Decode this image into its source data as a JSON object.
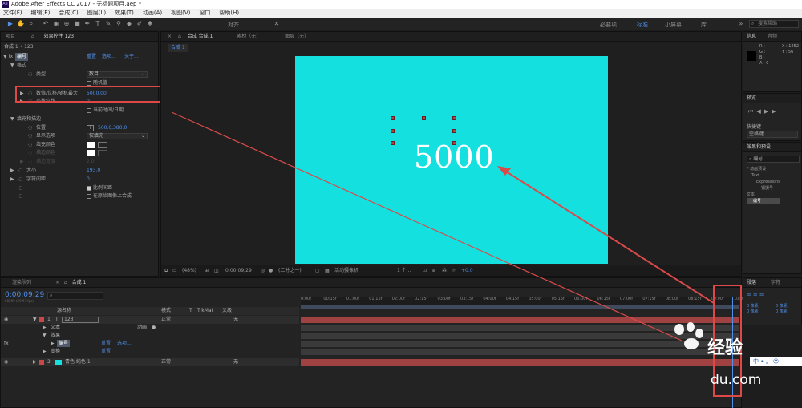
{
  "app": {
    "title": "Adobe After Effects CC 2017 - 无标题项目.aep *",
    "icon_label": "Ae"
  },
  "menu": [
    "文件(F)",
    "编辑(E)",
    "合成(C)",
    "图层(L)",
    "效果(T)",
    "动画(A)",
    "视图(V)",
    "窗口",
    "帮助(H)"
  ],
  "toolbar": {
    "align_label": "对齐",
    "workspaces": [
      "必要项",
      "标准",
      "小屏幕",
      "库"
    ],
    "active_workspace": "标准",
    "search_placeholder": "搜索帮助"
  },
  "effect_panel": {
    "tab_project": "项目",
    "tab_effect": "效果控件 123",
    "breadcrumb": "合成 1 • 123",
    "effect_name": "编号",
    "reset": "重置",
    "options": "选项...",
    "about": "关于...",
    "rows": [
      {
        "label": "格式",
        "value": ""
      },
      {
        "label": "类型",
        "value": "数目"
      },
      {
        "label": "",
        "value": "随机值"
      },
      {
        "label": "数值/位移/随机最大",
        "value": "5000.00"
      },
      {
        "label": "小数位数",
        "value": "0"
      },
      {
        "label": "",
        "value": "当前时间/日期"
      },
      {
        "label": "填充和描边",
        "value": ""
      },
      {
        "label": "位置",
        "value": "500.0,380.0"
      },
      {
        "label": "显示选项",
        "value": "仅填充"
      },
      {
        "label": "填充颜色",
        "value": ""
      },
      {
        "label": "描边颜色",
        "value": ""
      },
      {
        "label": "描边宽度",
        "value": "2.0"
      },
      {
        "label": "大小",
        "value": "193.0"
      },
      {
        "label": "字符间距",
        "value": "0"
      },
      {
        "label": "",
        "value": "比例间距"
      },
      {
        "label": "",
        "value": "在原始图像上合成"
      }
    ]
  },
  "viewer": {
    "tab_comp": "合成 合成 1",
    "tab_material": "素材（无）",
    "tab_layer": "图层（无）",
    "sub_tab": "合成 1",
    "display_text": "5000",
    "zoom": "(48%)",
    "timecode": "0;00;09;29",
    "resolution": "(二分之一)",
    "camera": "活动摄像机",
    "views": "1 个...",
    "exposure": "+0.0"
  },
  "timeline": {
    "tab_render": "渲染队列",
    "tab_comp": "合成 1",
    "timecode": "0;00;09;29",
    "frame_info": "00299 (29.97 fps)",
    "col_headers": [
      "源名称",
      "模式",
      "T",
      "TrkMat",
      "父级"
    ],
    "ticks": [
      "0:00f",
      "00:15f",
      "01:00f",
      "01:15f",
      "02:00f",
      "02:15f",
      "03:00f",
      "03:15f",
      "04:00f",
      "04:15f",
      "05:00f",
      "05:15f",
      "06:00f",
      "06:15f",
      "07:00f",
      "07:15f",
      "08:00f",
      "08:15f",
      "09:00f",
      "10:0"
    ],
    "layers": [
      {
        "index": "1",
        "name": "123",
        "mode": "正常",
        "parent": "无"
      },
      {
        "index": "",
        "name": "文本",
        "mode": "",
        "parent": ""
      },
      {
        "index": "",
        "name": "效果",
        "mode": "",
        "parent": ""
      },
      {
        "index": "",
        "name": "编号",
        "mode": "",
        "parent": ""
      },
      {
        "index": "",
        "name": "变换",
        "mode": "",
        "parent": ""
      },
      {
        "index": "2",
        "name": "青色 纯色 1",
        "mode": "正常",
        "parent": "无"
      }
    ],
    "animate_label": "动画：",
    "reset": "重置",
    "options": "选项..."
  },
  "right_panels": {
    "info_tab": "信息",
    "audio_tab": "音频",
    "info_rgb": [
      "R :",
      "G :",
      "B :",
      "A : 0"
    ],
    "info_xy": [
      "X : 1252",
      "Y : 56"
    ],
    "preview_tab": "预览",
    "shortcut_label": "快捷键",
    "shortcut_value": "空格键",
    "effects_tab": "效果和预设",
    "effects_search": "编号",
    "effects_tree": [
      "* 动画预设",
      "Text",
      "Expressions",
      "钢摄号",
      "文本",
      "编号"
    ],
    "paragraph_tab": "段落",
    "char_tab": "字符",
    "para_values": [
      "0 像素",
      "0 像素",
      "0 像素",
      "0 像素"
    ]
  },
  "watermark": {
    "brand": "经验",
    "domain": "du.com"
  },
  "taskbar_ime": [
    "中",
    "•",
    "。"
  ],
  "colors": {
    "accent": "#4f8fe8",
    "canvas": "#14e0e0",
    "highlight_box": "#e04848",
    "layer_bar": "#a14242"
  }
}
